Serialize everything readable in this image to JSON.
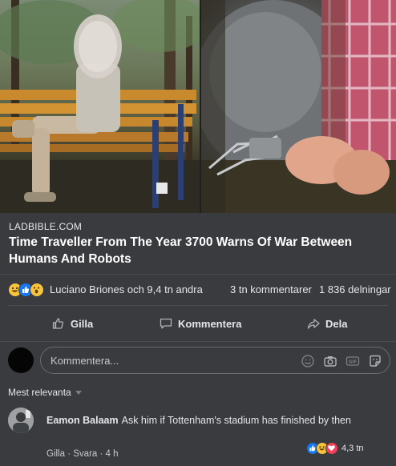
{
  "post": {
    "source": "LADBIBLE.COM",
    "headline": "Time Traveller From The Year 3700 Warns Of War Between Humans And Robots"
  },
  "reactions": {
    "icons": [
      "haha-icon",
      "like-icon",
      "wow-icon"
    ],
    "reactors_text": "Luciano Briones och 9,4 tn andra",
    "comments_text": "3 tn kommentarer",
    "shares_text": "1 836 delningar"
  },
  "actions": {
    "like_label": "Gilla",
    "comment_label": "Kommentera",
    "share_label": "Dela"
  },
  "composer": {
    "placeholder": "Kommentera..."
  },
  "sort": {
    "label": "Mest relevanta"
  },
  "comment": {
    "author": "Eamon Balaam",
    "text": "Ask him if Tottenham's stadium has finished by then",
    "like_label": "Gilla",
    "reply_label": "Svara",
    "time": "4 h",
    "reaction_count": "4,3 tn",
    "reaction_icons": [
      "like-icon",
      "haha-icon",
      "love-icon"
    ]
  },
  "colors": {
    "background": "#3a3b3f",
    "like_blue": "#1877f2",
    "love_red": "#f33e58",
    "haha_yellow": "#f7c43d"
  }
}
